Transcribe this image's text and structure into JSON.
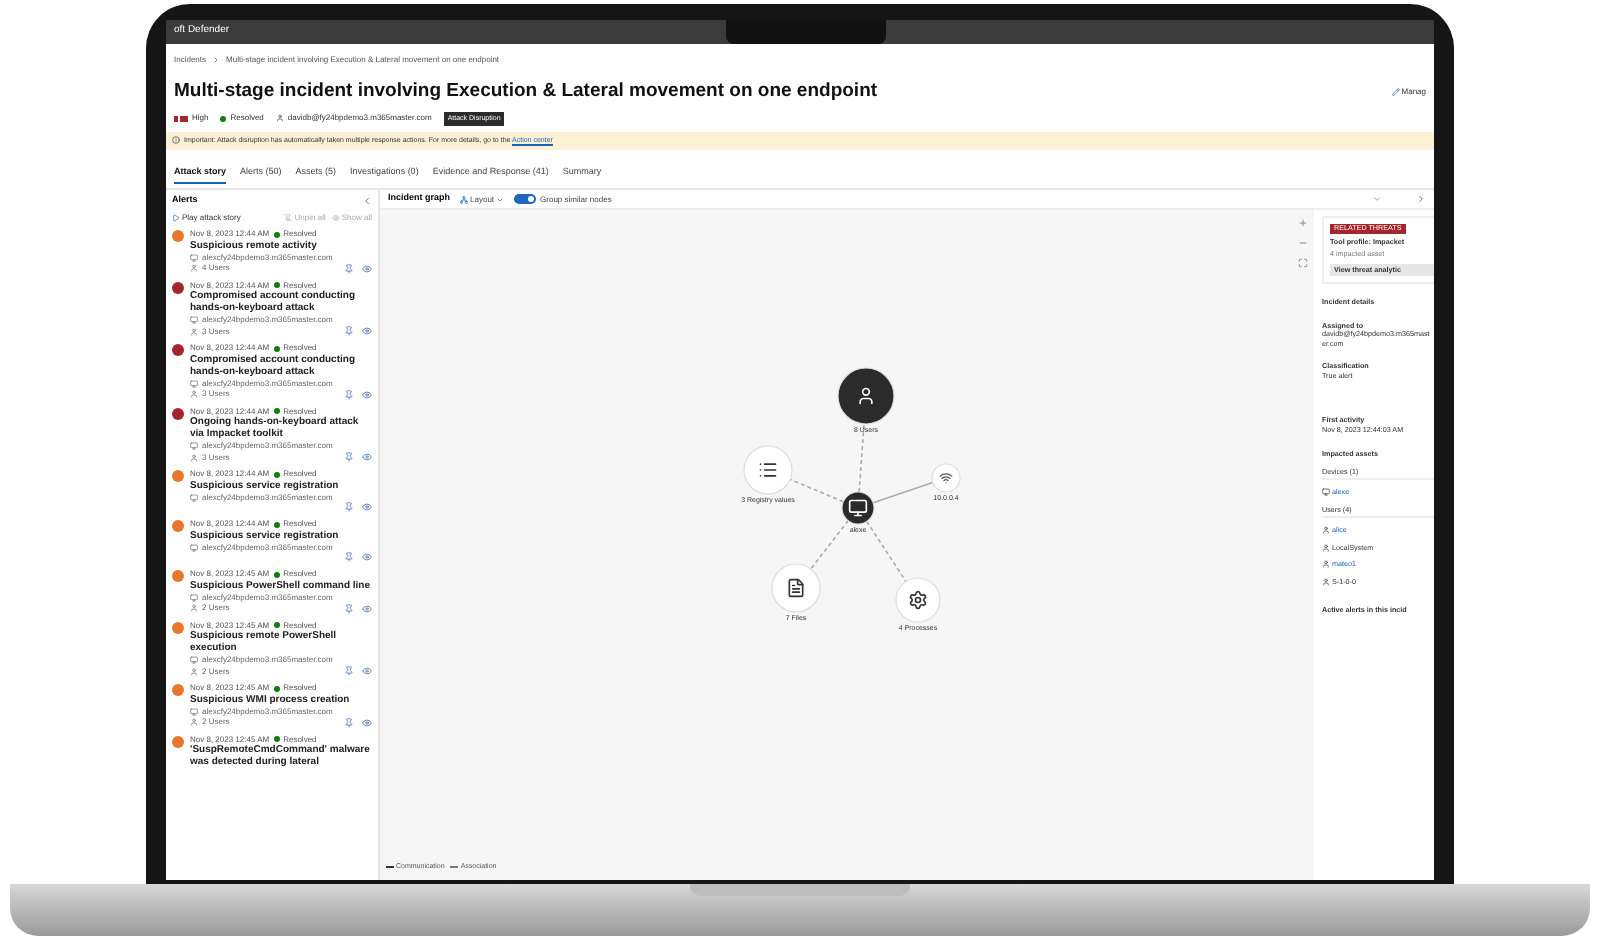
{
  "top_bar": {
    "app_title": "oft Defender"
  },
  "breadcrumb": [
    "Incidents",
    "Multi-stage incident involving Execution & Lateral movement on one endpoint"
  ],
  "header": {
    "title": "Multi-stage incident involving Execution & Lateral movement on one endpoint",
    "severity": "High",
    "status": "Resolved",
    "assignee": "davidb@fy24bpdemo3.m365master.com",
    "badge": "Attack Disruption",
    "manage": "Manag"
  },
  "banner": {
    "text": "Important: Attack disruption has automatically taken multiple response actions. For more details, go to the ",
    "link": "Action center"
  },
  "tabs": [
    {
      "label": "Attack story",
      "selected": true
    },
    {
      "label": "Alerts (50)",
      "selected": false
    },
    {
      "label": "Assets (5)",
      "selected": false
    },
    {
      "label": "Investigations (0)",
      "selected": false
    },
    {
      "label": "Evidence and Response (41)",
      "selected": false
    },
    {
      "label": "Summary",
      "selected": false
    }
  ],
  "alerts_panel": {
    "title": "Alerts",
    "play": "Play attack story",
    "unpin": "Unpin all",
    "show": "Show all",
    "alerts": [
      {
        "date": "Nov 8, 2023 12:44 AM",
        "status": "Resolved",
        "title": "Suspicious remote activity",
        "device": "alexcfy24bpdemo3.m365master.com",
        "users": "4 Users",
        "color": "#e8772e"
      },
      {
        "date": "Nov 8, 2023 12:44 AM",
        "status": "Resolved",
        "title": "Compromised account conducting hands-on-keyboard attack",
        "device": "alexcfy24bpdemo3.m365master.com",
        "users": "3 Users",
        "color": "#a4262c"
      },
      {
        "date": "Nov 8, 2023 12:44 AM",
        "status": "Resolved",
        "title": "Compromised account conducting hands-on-keyboard attack",
        "device": "alexcfy24bpdemo3.m365master.com",
        "users": "3 Users",
        "color": "#a4262c"
      },
      {
        "date": "Nov 8, 2023 12:44 AM",
        "status": "Resolved",
        "title": "Ongoing hands-on-keyboard attack via Impacket toolkit",
        "device": "alexcfy24bpdemo3.m365master.com",
        "users": "3 Users",
        "color": "#a4262c"
      },
      {
        "date": "Nov 8, 2023 12:44 AM",
        "status": "Resolved",
        "title": "Suspicious service registration",
        "device": "alexcfy24bpdemo3.m365master.com",
        "color": "#e8772e"
      },
      {
        "date": "Nov 8, 2023 12:44 AM",
        "status": "Resolved",
        "title": "Suspicious service registration",
        "device": "alexcfy24bpdemo3.m365master.com",
        "color": "#e8772e"
      },
      {
        "date": "Nov 8, 2023 12:45 AM",
        "status": "Resolved",
        "title": "Suspicious PowerShell command line",
        "device": "alexcfy24bpdemo3.m365master.com",
        "users": "2 Users",
        "color": "#e8772e"
      },
      {
        "date": "Nov 8, 2023 12:45 AM",
        "status": "Resolved",
        "title": "Suspicious remote PowerShell execution",
        "device": "alexcfy24bpdemo3.m365master.com",
        "users": "2 Users",
        "color": "#e8772e"
      },
      {
        "date": "Nov 8, 2023 12:45 AM",
        "status": "Resolved",
        "title": "Suspicious WMI process creation",
        "device": "alexcfy24bpdemo3.m365master.com",
        "users": "2 Users",
        "color": "#e8772e"
      },
      {
        "date": "Nov 8, 2023 12:45 AM",
        "status": "Resolved",
        "title": "'SuspRemoteCmdCommand' malware was detected during lateral",
        "color": "#e8772e"
      }
    ]
  },
  "graph": {
    "title": "Incident graph",
    "layout": "Layout",
    "group_toggle": {
      "label": "Group similar nodes",
      "on": true
    },
    "nodes": [
      {
        "kind": "device",
        "label": "alexe"
      },
      {
        "kind": "user",
        "label": "8 Users"
      },
      {
        "kind": "registry",
        "label": "3 Registry values"
      },
      {
        "kind": "ip",
        "label": "10.0.0.4"
      },
      {
        "kind": "file",
        "label": "7 Files"
      },
      {
        "kind": "process",
        "label": "4 Processes"
      }
    ],
    "legend": [
      "Communication",
      "Association"
    ]
  },
  "side_panel": {
    "threat_tag": "RELATED THREATS",
    "threat_title": "Tool profile: Impacket",
    "threat_sub": "4 impacted asset",
    "threat_button": "View threat analytic",
    "details_heading": "Incident details",
    "fields": [
      {
        "label": "Assigned to",
        "value": "davidb@fy24bpdemo3.m365master.com"
      },
      {
        "label": "Classification",
        "value": "True alert"
      },
      {
        "label": "First activity",
        "value": "Nov 8, 2023 12:44:03 AM"
      }
    ],
    "assets_heading": "Impacted assets",
    "groups": [
      {
        "label": "Devices (1)",
        "items": [
          {
            "kind": "device",
            "name": "alexe",
            "link": true
          }
        ]
      },
      {
        "label": "Users (4)",
        "items": [
          {
            "kind": "user",
            "name": "alice",
            "link": true
          },
          {
            "kind": "user",
            "name": "LocalSystem",
            "link": false
          },
          {
            "kind": "user",
            "name": "mateo1",
            "link": true
          },
          {
            "kind": "user",
            "name": "S-1-0-0",
            "link": false
          }
        ]
      }
    ],
    "active_alerts": "Active alerts in this incid"
  }
}
